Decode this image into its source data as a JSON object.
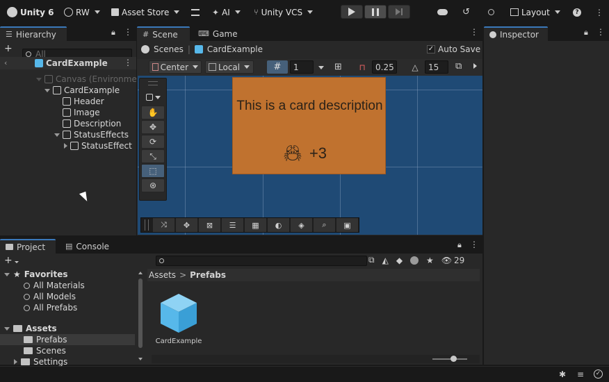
{
  "topbar": {
    "product": "Unity 6",
    "account": "RW",
    "asset_store": "Asset Store",
    "ai": "AI",
    "vcs": "Unity VCS",
    "layout": "Layout"
  },
  "hierarchy": {
    "tab": "Hierarchy",
    "search_placeholder": "All",
    "root": "CardExample",
    "items": [
      {
        "label": "Canvas (Environment)"
      },
      {
        "label": "CardExample"
      },
      {
        "label": "Header"
      },
      {
        "label": "Image"
      },
      {
        "label": "Description"
      },
      {
        "label": "StatusEffects"
      },
      {
        "label": "StatusEffect"
      }
    ]
  },
  "scene": {
    "tabs": [
      "Scene",
      "Game"
    ],
    "breadcrumb_root": "Scenes",
    "breadcrumb_current": "CardExample",
    "auto_save": "Auto Save",
    "pivot": "Center",
    "space": "Local",
    "grid_value": "1",
    "snap_value": "0.25",
    "angle_value": "15",
    "card_text": "This is a card description",
    "card_stat": "+3"
  },
  "inspector": {
    "tab": "Inspector"
  },
  "project": {
    "tabs": [
      "Project",
      "Console"
    ],
    "visible_count": "29",
    "breadcrumb": [
      "Assets",
      "Prefabs"
    ],
    "favorites_label": "Favorites",
    "favorites": [
      "All Materials",
      "All Models",
      "All Prefabs"
    ],
    "assets_label": "Assets",
    "folders": [
      "Prefabs",
      "Scenes",
      "Settings"
    ],
    "asset_item": "CardExample"
  },
  "colors": {
    "accent": "#3a79bb",
    "card": "#c0722f",
    "scene_bg": "#1f4a75",
    "prefab_blue": "#57b8ea"
  }
}
